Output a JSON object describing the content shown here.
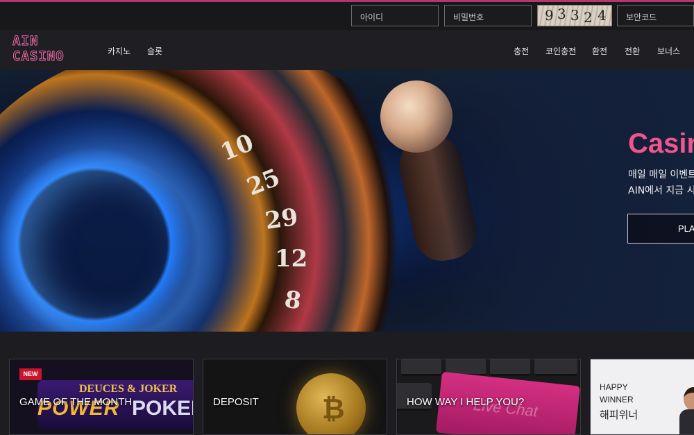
{
  "login": {
    "id_placeholder": "아이디",
    "password_placeholder": "비밀번호",
    "captcha_digits": [
      "9",
      "3",
      "3",
      "2",
      "4"
    ],
    "security_code_placeholder": "보안코드"
  },
  "brand": {
    "logo_line1": "AIN",
    "logo_line2": "CASINO"
  },
  "nav": {
    "left": [
      "카지노",
      "슬롯"
    ],
    "right": [
      "충전",
      "코인충전",
      "환전",
      "전환",
      "보너스"
    ]
  },
  "hero": {
    "title": "Casino",
    "line1": "매일 매일 이벤트",
    "line2": "AIN에서 지금 시",
    "button_label": "PLAY",
    "wheel_numbers": [
      "10",
      "25",
      "29",
      "12",
      "8"
    ]
  },
  "cards": [
    {
      "label": "GAME OF THE MONTH",
      "badge": "NEW",
      "art_line1": "DEUCES & JOKER",
      "art_power": "POWER",
      "art_poker": "POKER"
    },
    {
      "label": "DEPOSIT"
    },
    {
      "label": "HOW WAY I HELP YOU?",
      "key_text": "Live Chat"
    },
    {
      "line1": "HAPPY",
      "line2": "WINNER",
      "line3": "해피위너"
    }
  ],
  "colors": {
    "accent": "#f0558e",
    "topline": "#b5366a",
    "new_badge": "#c8152b"
  }
}
